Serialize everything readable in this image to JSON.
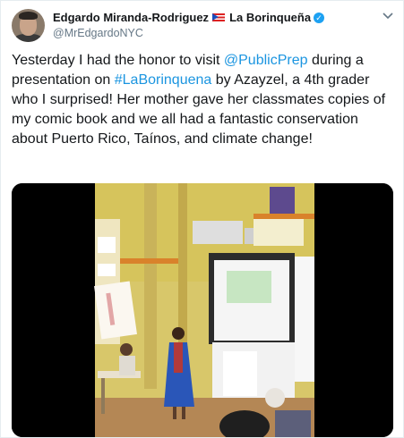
{
  "tweet": {
    "author_name": "Edgardo Miranda-Rodriguez",
    "flag_emoji": "puerto-rico-flag",
    "project_name": "La Borinqueña",
    "handle": "@MrEdgardoNYC",
    "text_part1": "Yesterday I had the honor to visit ",
    "mention": "@PublicPrep",
    "text_part2": " during a presentation on ",
    "hashtag": "#LaBorinquena",
    "text_part3": " by Azayzel, a 4th grader who I surprised! Her mother gave her classmates copies of my comic book and we all had a fantastic conservation about Puerto Rico, Taínos, and climate change!",
    "media_description": "video-thumbnail-classroom",
    "link_color": "#1b95e0",
    "verified_color": "#1da1f2"
  }
}
